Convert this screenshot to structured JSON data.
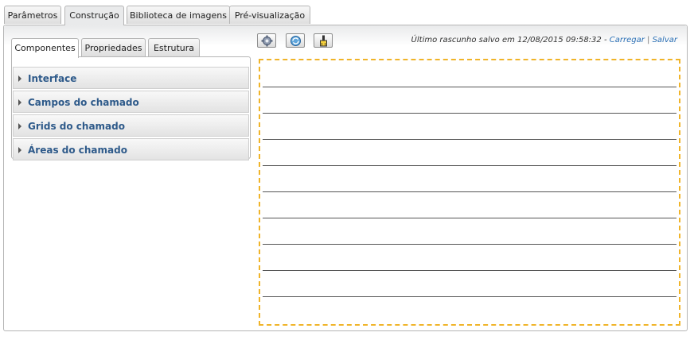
{
  "top_tabs": [
    {
      "label": "Parâmetros",
      "active": false
    },
    {
      "label": "Construção",
      "active": true
    },
    {
      "label": "Biblioteca de imagens",
      "active": false
    },
    {
      "label": "Pré-visualização",
      "active": false
    }
  ],
  "inner_tabs": [
    {
      "label": "Componentes",
      "active": true
    },
    {
      "label": "Propriedades",
      "active": false
    },
    {
      "label": "Estrutura",
      "active": false
    }
  ],
  "accordion": [
    {
      "label": "Interface"
    },
    {
      "label": "Campos do chamado"
    },
    {
      "label": "Grids do chamado"
    },
    {
      "label": "Áreas do chamado"
    }
  ],
  "toolbar": {
    "icons": [
      "settings-gear-icon",
      "refresh-globe-icon",
      "brush-icon"
    ]
  },
  "status": {
    "text": "Último rascunho salvo em 12/08/2015 09:58:32 - ",
    "load_link": "Carregar",
    "separator": "|",
    "save_link": "Salvar"
  },
  "colors": {
    "accordion_text": "#2e5a8a",
    "link": "#2a6fb5",
    "canvas_border": "#f0b429"
  }
}
